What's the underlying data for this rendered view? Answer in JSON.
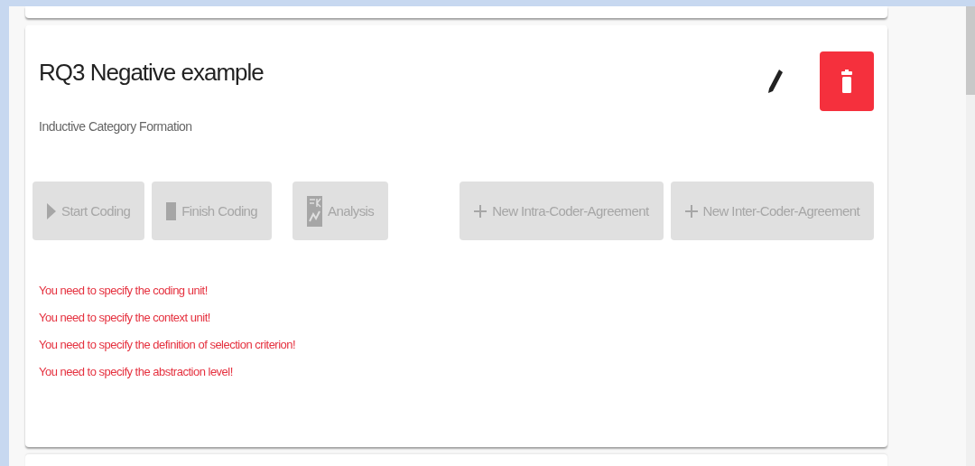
{
  "card": {
    "title": "RQ3 Negative example",
    "subtitle": "Inductive Category Formation",
    "actions": [
      {
        "kind": "edit"
      },
      {
        "kind": "delete"
      }
    ],
    "coding_buttons": [
      {
        "kind": "play",
        "label": "Start Coding",
        "disabled": true
      },
      {
        "kind": "stop",
        "label": "Finish Coding",
        "disabled": true
      },
      {
        "kind": "chart",
        "label": "Analysis",
        "disabled": true
      }
    ],
    "agreement_buttons": [
      {
        "kind": "plus",
        "label": "New Intra-Coder-Agreement",
        "disabled": true
      },
      {
        "kind": "plus",
        "label": "New Inter-Coder-Agreement",
        "disabled": true
      }
    ],
    "errors": [
      "You need to specify the coding unit!",
      "You need to specify the context unit!",
      "You need to specify the definition of selection criterion!",
      "You need to specify the abstraction level!"
    ]
  }
}
